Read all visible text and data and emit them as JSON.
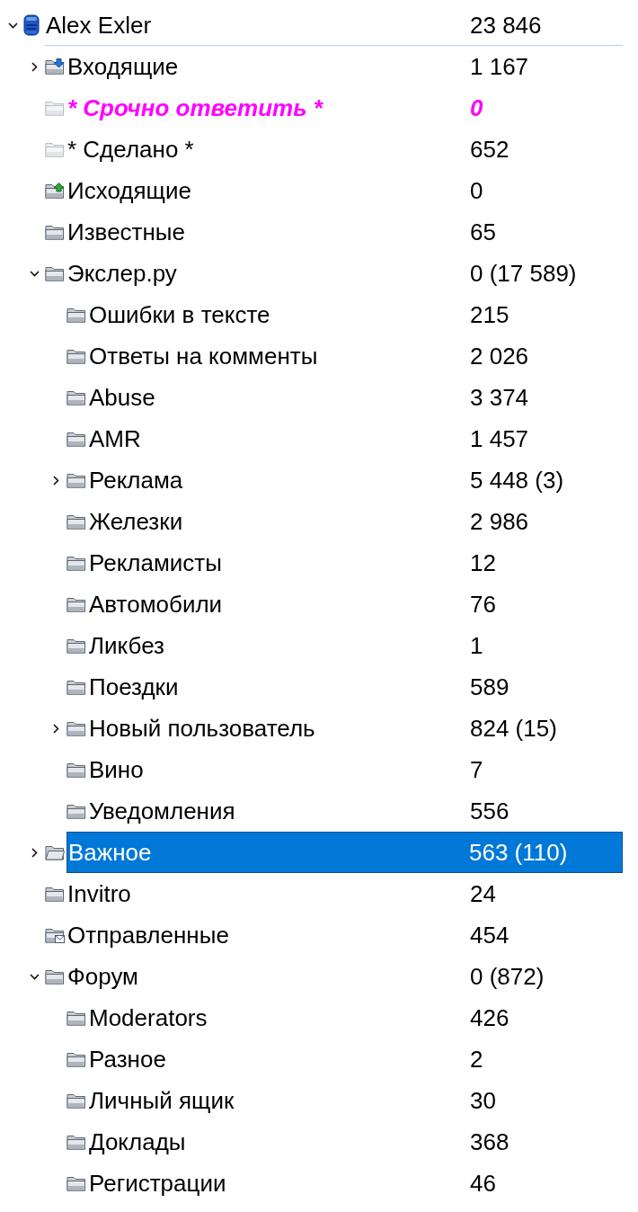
{
  "tree": [
    {
      "name": "Alex Exler",
      "count": "23 846",
      "kind": "account",
      "expanded": true,
      "selected": false,
      "children": [
        {
          "name": "Входящие",
          "count": "1 167",
          "kind": "inbox",
          "expanded": false,
          "selected": false
        },
        {
          "name": "* Срочно ответить *",
          "count": "0",
          "kind": "saved-search",
          "color": "#ff00ff",
          "selected": false
        },
        {
          "name": "* Сделано *",
          "count": "652",
          "kind": "saved-search",
          "selected": false
        },
        {
          "name": "Исходящие",
          "count": "0",
          "kind": "outbox",
          "selected": false
        },
        {
          "name": "Известные",
          "count": "65",
          "kind": "folder",
          "selected": false
        },
        {
          "name": "Экслер.ру",
          "count": "0 (17 589)",
          "kind": "folder",
          "expanded": true,
          "selected": false,
          "children": [
            {
              "name": "Ошибки в тексте",
              "count": "215",
              "kind": "folder",
              "selected": false
            },
            {
              "name": "Ответы на комменты",
              "count": "2 026",
              "kind": "folder",
              "selected": false
            },
            {
              "name": "Abuse",
              "count": "3 374",
              "kind": "folder",
              "selected": false
            },
            {
              "name": "AMR",
              "count": "1 457",
              "kind": "folder",
              "selected": false
            },
            {
              "name": "Реклама",
              "count": "5 448 (3)",
              "kind": "folder",
              "expanded": false,
              "selected": false
            },
            {
              "name": "Железки",
              "count": "2 986",
              "kind": "folder",
              "selected": false
            },
            {
              "name": "Рекламисты",
              "count": "12",
              "kind": "folder",
              "selected": false
            },
            {
              "name": "Автомобили",
              "count": "76",
              "kind": "folder",
              "selected": false
            },
            {
              "name": "Ликбез",
              "count": "1",
              "kind": "folder",
              "selected": false
            },
            {
              "name": "Поездки",
              "count": "589",
              "kind": "folder",
              "selected": false
            },
            {
              "name": "Новый пользователь",
              "count": "824 (15)",
              "kind": "folder",
              "expanded": false,
              "selected": false
            },
            {
              "name": "Вино",
              "count": "7",
              "kind": "folder",
              "selected": false
            },
            {
              "name": "Уведомления",
              "count": "556",
              "kind": "folder",
              "selected": false
            }
          ]
        },
        {
          "name": "Важное",
          "count": "563 (110)",
          "kind": "folder",
          "expanded": false,
          "selected": true
        },
        {
          "name": "Invitro",
          "count": "24",
          "kind": "folder",
          "selected": false
        },
        {
          "name": "Отправленные",
          "count": "454",
          "kind": "sent",
          "selected": false
        },
        {
          "name": "Форум",
          "count": "0 (872)",
          "kind": "folder",
          "expanded": true,
          "selected": false,
          "children": [
            {
              "name": "Moderators",
              "count": "426",
              "kind": "folder",
              "selected": false
            },
            {
              "name": "Разное",
              "count": "2",
              "kind": "folder",
              "selected": false
            },
            {
              "name": "Личный ящик",
              "count": "30",
              "kind": "folder",
              "selected": false
            },
            {
              "name": "Доклады",
              "count": "368",
              "kind": "folder",
              "selected": false
            },
            {
              "name": "Регистрации",
              "count": "46",
              "kind": "folder",
              "selected": false
            }
          ]
        }
      ]
    }
  ]
}
